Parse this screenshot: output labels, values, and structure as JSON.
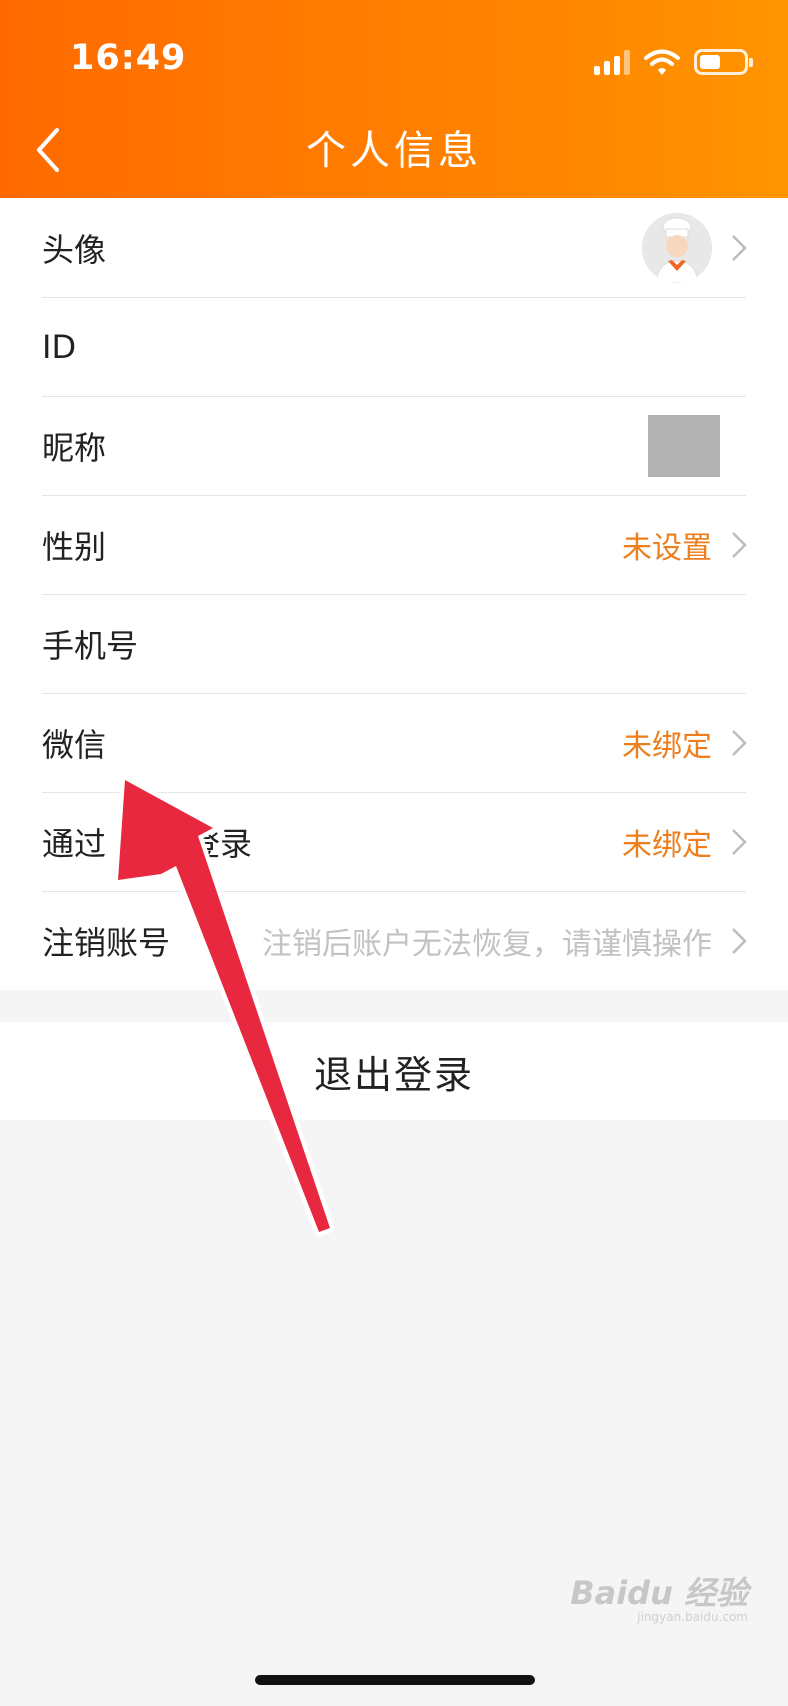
{
  "status_bar": {
    "time": "16:49"
  },
  "header": {
    "title": "个人信息"
  },
  "rows": [
    {
      "label": "头像",
      "value": ""
    },
    {
      "label": "ID",
      "value": ""
    },
    {
      "label": "昵称",
      "value": ""
    },
    {
      "label": "性别",
      "value": "未设置"
    },
    {
      "label": "手机号",
      "value": ""
    },
    {
      "label": "微信",
      "value": "未绑定"
    },
    {
      "label": "通过",
      "label_tail": "登录",
      "value": "未绑定"
    },
    {
      "label": "注销账号",
      "value": "注销后账户无法恢复，请谨慎操作"
    }
  ],
  "logout_label": "退出登录",
  "watermark": {
    "brand": "Baidu 经验",
    "url": "jingyan.baidu.com"
  },
  "colors": {
    "header_start": "#ff6a00",
    "header_end": "#ff9400",
    "accent_value": "#ee7d1c",
    "hint": "#c2c2c2",
    "arrow": "#e8283f"
  }
}
